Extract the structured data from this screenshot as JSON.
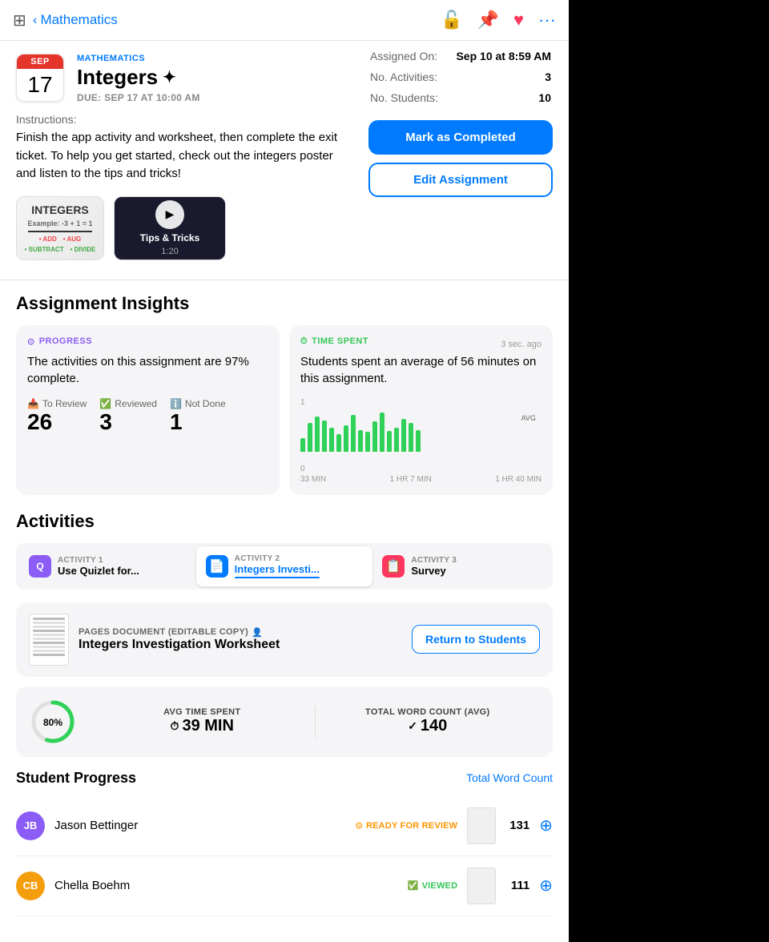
{
  "nav": {
    "back_label": "Mathematics",
    "icon_lock": "🔓",
    "icon_pin": "📌",
    "icon_heart": "♥",
    "icon_more": "•••"
  },
  "header": {
    "month": "SEP",
    "day": "17",
    "subject": "MATHEMATICS",
    "title": "Integers",
    "sparkle": "✦",
    "due": "DUE: SEP 17 AT 10:00 AM"
  },
  "meta": {
    "assigned_label": "Assigned On:",
    "assigned_value": "Sep 10 at 8:59 AM",
    "activities_label": "No. Activities:",
    "activities_value": "3",
    "students_label": "No. Students:",
    "students_value": "10"
  },
  "buttons": {
    "complete": "Mark as Completed",
    "edit": "Edit Assignment"
  },
  "instructions": {
    "label": "Instructions:",
    "text": "Finish the app activity and worksheet, then complete the exit ticket. To help you get started, check out the integers poster and listen to the tips and tricks!"
  },
  "media": {
    "poster_title": "INTEGERS",
    "video_title": "Tips & Tricks",
    "video_duration": "1:20"
  },
  "insights": {
    "section_title": "Assignment Insights",
    "progress": {
      "badge": "PROGRESS",
      "text": "The activities on this assignment are 97% complete.",
      "stats": [
        {
          "label": "To Review",
          "icon": "📥",
          "value": "26"
        },
        {
          "label": "Reviewed",
          "icon": "✅",
          "value": "3"
        },
        {
          "label": "Not Done",
          "icon": "ℹ️",
          "value": "1"
        }
      ]
    },
    "time": {
      "badge": "TIME SPENT",
      "ago": "3 sec. ago",
      "text": "Students spent an average of 56 minutes on this assignment.",
      "chart_labels": [
        "33 MIN",
        "1 HR 7 MIN",
        "1 HR 40 MIN"
      ],
      "bars": [
        20,
        50,
        60,
        55,
        45,
        30,
        50,
        65,
        40,
        35,
        55,
        70,
        38,
        45,
        60,
        55,
        40
      ]
    }
  },
  "activities": {
    "section_title": "Activities",
    "tabs": [
      {
        "id": "act1",
        "label": "ACTIVITY 1",
        "name": "Use Quizlet for...",
        "icon": "Q",
        "active": false
      },
      {
        "id": "act2",
        "label": "ACTIVITY 2",
        "name": "Integers Investi...",
        "icon": "📄",
        "active": true
      },
      {
        "id": "act3",
        "label": "ACTIVITY 3",
        "name": "Survey",
        "icon": "📋",
        "active": false
      }
    ],
    "worksheet": {
      "type": "PAGES DOCUMENT (EDITABLE COPY)",
      "title": "Integers Investigation Worksheet",
      "return_btn": "Return to Students"
    },
    "metrics": {
      "progress_pct": 80,
      "avg_time_label": "AVG TIME SPENT",
      "avg_time_value": "39 MIN",
      "word_count_label": "TOTAL WORD COUNT (AVG)",
      "word_count_value": "140"
    }
  },
  "student_progress": {
    "title": "Student Progress",
    "link": "Total Word Count",
    "students": [
      {
        "initials": "JB",
        "name": "Jason Bettinger",
        "status": "READY FOR REVIEW",
        "status_type": "orange",
        "word_count": "131",
        "avatar_color": "#8B5CF6"
      },
      {
        "initials": "CB",
        "name": "Chella Boehm",
        "status": "VIEWED",
        "status_type": "green",
        "word_count": "111",
        "avatar_color": "#F59E0B"
      }
    ]
  }
}
